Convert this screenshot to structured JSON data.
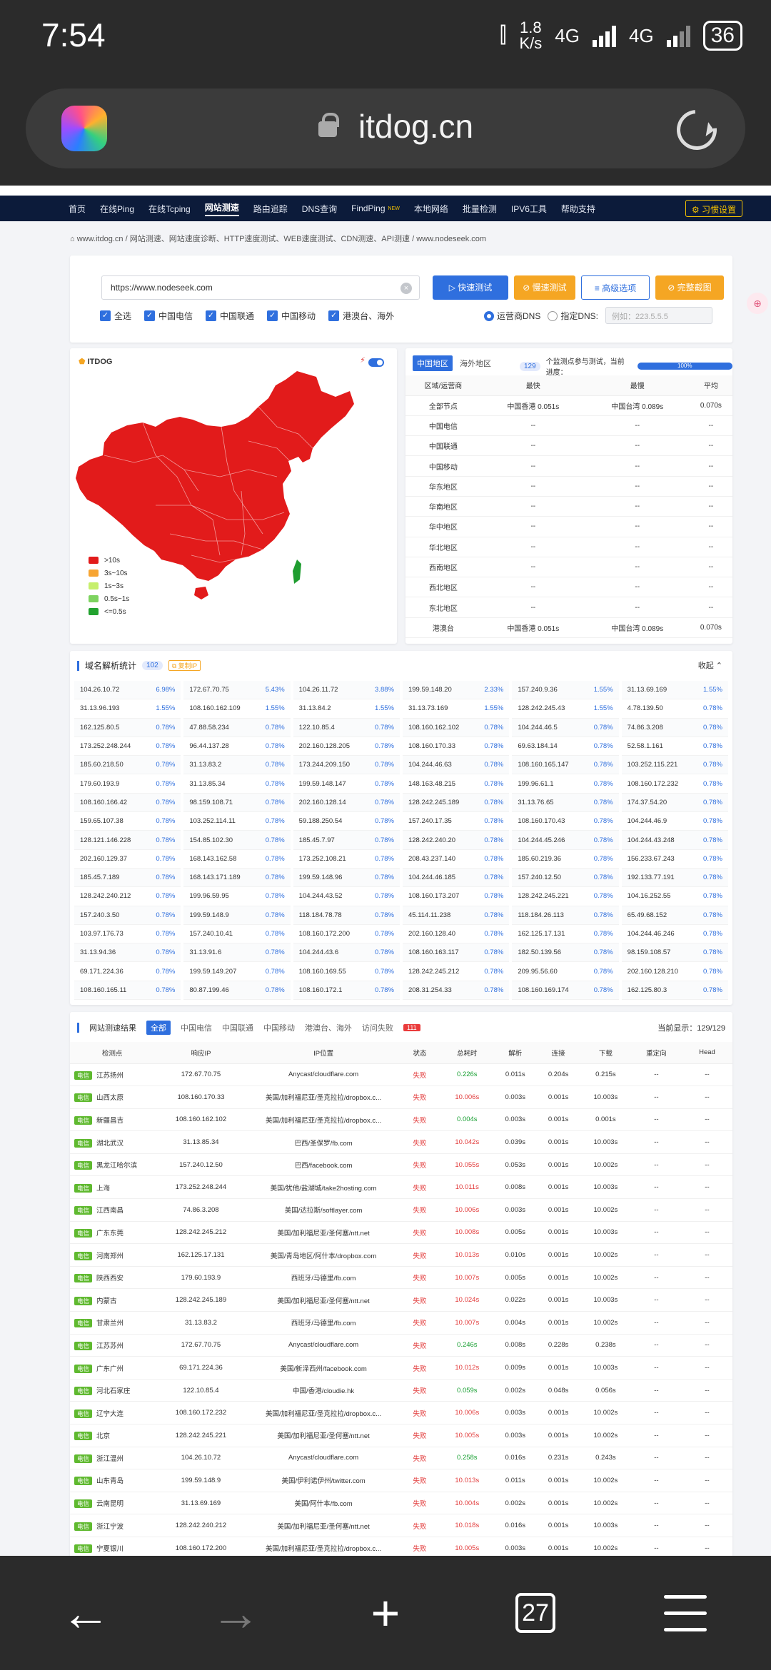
{
  "status": {
    "time": "7:54",
    "speed_top": "1.8",
    "speed_unit": "K/s",
    "net1": "4G",
    "net2": "4G",
    "battery": "36"
  },
  "browser": {
    "url": "itdog.cn",
    "tab_count": "27",
    "back": "←",
    "forward": "→",
    "new_tab": "+"
  },
  "nav": {
    "items": [
      "首页",
      "在线Ping",
      "在线Tcping",
      "网站测速",
      "路由追踪",
      "DNS查询",
      "FindPing",
      "本地网络",
      "批量检测",
      "IPV6工具",
      "帮助支持"
    ],
    "active_index": 3,
    "new_badge": "NEW",
    "settings": "习惯设置"
  },
  "breadcrumb": [
    "www.itdog.cn",
    "网站测速、网站速度诊断、HTTP速度测试、WEB速度测试、CDN测速、API测速",
    "www.nodeseek.com"
  ],
  "search": {
    "value": "https://www.nodeseek.com",
    "clear": "×",
    "buttons": {
      "fast": "▷ 快速测试",
      "slow": "⊘ 慢速测试",
      "advanced": "≡ 高级选项",
      "full": "⊘ 完整截图"
    },
    "checks": [
      "全选",
      "中国电信",
      "中国联通",
      "中国移动",
      "港澳台、海外"
    ],
    "dns_operator": "运营商DNS",
    "dns_custom": "指定DNS:",
    "dns_placeholder": "例如：223.5.5.5"
  },
  "map": {
    "logo": "ITDOG",
    "legend": [
      {
        "label": ">10s",
        "color": "#e21b1b"
      },
      {
        "label": "3s~10s",
        "color": "#f7a533"
      },
      {
        "label": "1s~3s",
        "color": "#c6ef6c"
      },
      {
        "label": "0.5s~1s",
        "color": "#7dd35f"
      },
      {
        "label": "<=0.5s",
        "color": "#22a22f"
      }
    ],
    "fill_color": "#e21b1b",
    "taiwan_color": "#1f9d30"
  },
  "regions": {
    "tab_cn": "中国地区",
    "tab_overseas": "海外地区",
    "count": "129",
    "progress_text": "个监测点参与测试，当前进度：",
    "progress": "100%",
    "headers": [
      "区域/运营商",
      "最快",
      "最慢",
      "平均"
    ],
    "rows": [
      [
        "全部节点",
        "中国香港 0.051s",
        "中国台湾 0.089s",
        "0.070s"
      ],
      [
        "中国电信",
        "--",
        "--",
        "--"
      ],
      [
        "中国联通",
        "--",
        "--",
        "--"
      ],
      [
        "中国移动",
        "--",
        "--",
        "--"
      ],
      [
        "华东地区",
        "--",
        "--",
        "--"
      ],
      [
        "华南地区",
        "--",
        "--",
        "--"
      ],
      [
        "华中地区",
        "--",
        "--",
        "--"
      ],
      [
        "华北地区",
        "--",
        "--",
        "--"
      ],
      [
        "西南地区",
        "--",
        "--",
        "--"
      ],
      [
        "西北地区",
        "--",
        "--",
        "--"
      ],
      [
        "东北地区",
        "--",
        "--",
        "--"
      ],
      [
        "港澳台",
        "中国香港 0.051s",
        "中国台湾 0.089s",
        "0.070s"
      ]
    ]
  },
  "dns_stats": {
    "title": "域名解析统计",
    "count": "102",
    "copy": "复制IP",
    "collapse": "收起 ⌃",
    "cells": [
      [
        "104.26.10.72",
        "6.98%"
      ],
      [
        "172.67.70.75",
        "5.43%"
      ],
      [
        "104.26.11.72",
        "3.88%"
      ],
      [
        "199.59.148.20",
        "2.33%"
      ],
      [
        "157.240.9.36",
        "1.55%"
      ],
      [
        "31.13.69.169",
        "1.55%"
      ],
      [
        "31.13.96.193",
        "1.55%"
      ],
      [
        "108.160.162.109",
        "1.55%"
      ],
      [
        "31.13.84.2",
        "1.55%"
      ],
      [
        "31.13.73.169",
        "1.55%"
      ],
      [
        "128.242.245.43",
        "1.55%"
      ],
      [
        "4.78.139.50",
        "0.78%"
      ],
      [
        "162.125.80.5",
        "0.78%"
      ],
      [
        "47.88.58.234",
        "0.78%"
      ],
      [
        "122.10.85.4",
        "0.78%"
      ],
      [
        "108.160.162.102",
        "0.78%"
      ],
      [
        "104.244.46.5",
        "0.78%"
      ],
      [
        "74.86.3.208",
        "0.78%"
      ],
      [
        "173.252.248.244",
        "0.78%"
      ],
      [
        "96.44.137.28",
        "0.78%"
      ],
      [
        "202.160.128.205",
        "0.78%"
      ],
      [
        "108.160.170.33",
        "0.78%"
      ],
      [
        "69.63.184.14",
        "0.78%"
      ],
      [
        "52.58.1.161",
        "0.78%"
      ],
      [
        "185.60.218.50",
        "0.78%"
      ],
      [
        "31.13.83.2",
        "0.78%"
      ],
      [
        "173.244.209.150",
        "0.78%"
      ],
      [
        "104.244.46.63",
        "0.78%"
      ],
      [
        "108.160.165.147",
        "0.78%"
      ],
      [
        "103.252.115.221",
        "0.78%"
      ],
      [
        "179.60.193.9",
        "0.78%"
      ],
      [
        "31.13.85.34",
        "0.78%"
      ],
      [
        "199.59.148.147",
        "0.78%"
      ],
      [
        "148.163.48.215",
        "0.78%"
      ],
      [
        "199.96.61.1",
        "0.78%"
      ],
      [
        "108.160.172.232",
        "0.78%"
      ],
      [
        "108.160.166.42",
        "0.78%"
      ],
      [
        "98.159.108.71",
        "0.78%"
      ],
      [
        "202.160.128.14",
        "0.78%"
      ],
      [
        "128.242.245.189",
        "0.78%"
      ],
      [
        "31.13.76.65",
        "0.78%"
      ],
      [
        "174.37.54.20",
        "0.78%"
      ],
      [
        "159.65.107.38",
        "0.78%"
      ],
      [
        "103.252.114.11",
        "0.78%"
      ],
      [
        "59.188.250.54",
        "0.78%"
      ],
      [
        "157.240.17.35",
        "0.78%"
      ],
      [
        "108.160.170.43",
        "0.78%"
      ],
      [
        "104.244.46.9",
        "0.78%"
      ],
      [
        "128.121.146.228",
        "0.78%"
      ],
      [
        "154.85.102.30",
        "0.78%"
      ],
      [
        "185.45.7.97",
        "0.78%"
      ],
      [
        "128.242.240.20",
        "0.78%"
      ],
      [
        "104.244.45.246",
        "0.78%"
      ],
      [
        "104.244.43.248",
        "0.78%"
      ],
      [
        "202.160.129.37",
        "0.78%"
      ],
      [
        "168.143.162.58",
        "0.78%"
      ],
      [
        "173.252.108.21",
        "0.78%"
      ],
      [
        "208.43.237.140",
        "0.78%"
      ],
      [
        "185.60.219.36",
        "0.78%"
      ],
      [
        "156.233.67.243",
        "0.78%"
      ],
      [
        "185.45.7.189",
        "0.78%"
      ],
      [
        "168.143.171.189",
        "0.78%"
      ],
      [
        "199.59.148.96",
        "0.78%"
      ],
      [
        "104.244.46.185",
        "0.78%"
      ],
      [
        "157.240.12.50",
        "0.78%"
      ],
      [
        "192.133.77.191",
        "0.78%"
      ],
      [
        "128.242.240.212",
        "0.78%"
      ],
      [
        "199.96.59.95",
        "0.78%"
      ],
      [
        "104.244.43.52",
        "0.78%"
      ],
      [
        "108.160.173.207",
        "0.78%"
      ],
      [
        "128.242.245.221",
        "0.78%"
      ],
      [
        "104.16.252.55",
        "0.78%"
      ],
      [
        "157.240.3.50",
        "0.78%"
      ],
      [
        "199.59.148.9",
        "0.78%"
      ],
      [
        "118.184.78.78",
        "0.78%"
      ],
      [
        "45.114.11.238",
        "0.78%"
      ],
      [
        "118.184.26.113",
        "0.78%"
      ],
      [
        "65.49.68.152",
        "0.78%"
      ],
      [
        "103.97.176.73",
        "0.78%"
      ],
      [
        "157.240.10.41",
        "0.78%"
      ],
      [
        "108.160.172.200",
        "0.78%"
      ],
      [
        "202.160.128.40",
        "0.78%"
      ],
      [
        "162.125.17.131",
        "0.78%"
      ],
      [
        "104.244.46.246",
        "0.78%"
      ],
      [
        "31.13.94.36",
        "0.78%"
      ],
      [
        "31.13.91.6",
        "0.78%"
      ],
      [
        "104.244.43.6",
        "0.78%"
      ],
      [
        "108.160.163.117",
        "0.78%"
      ],
      [
        "182.50.139.56",
        "0.78%"
      ],
      [
        "98.159.108.57",
        "0.78%"
      ],
      [
        "69.171.224.36",
        "0.78%"
      ],
      [
        "199.59.149.207",
        "0.78%"
      ],
      [
        "108.160.169.55",
        "0.78%"
      ],
      [
        "128.242.245.212",
        "0.78%"
      ],
      [
        "209.95.56.60",
        "0.78%"
      ],
      [
        "202.160.128.210",
        "0.78%"
      ],
      [
        "108.160.165.11",
        "0.78%"
      ],
      [
        "80.87.199.46",
        "0.78%"
      ],
      [
        "108.160.172.1",
        "0.78%"
      ],
      [
        "208.31.254.33",
        "0.78%"
      ],
      [
        "108.160.169.174",
        "0.78%"
      ],
      [
        "162.125.80.3",
        "0.78%"
      ]
    ]
  },
  "results": {
    "title": "网站测速结果",
    "filters": [
      "全部",
      "中国电信",
      "中国联通",
      "中国移动",
      "港澳台、海外",
      "访问失败"
    ],
    "fail_count": "111",
    "shown": "当前显示：129/129",
    "headers": [
      "检测点",
      "响应IP",
      "IP位置",
      "状态",
      "总耗时",
      "解析",
      "连接",
      "下载",
      "重定向",
      "Head"
    ],
    "rows": [
      [
        "电信",
        "江苏扬州",
        "172.67.70.75",
        "Anycast/cloudflare.com",
        "失败",
        "0.226s",
        "g",
        "0.011s",
        "0.204s",
        "0.215s",
        "--",
        "--"
      ],
      [
        "电信",
        "山西太原",
        "108.160.170.33",
        "美国/加利福尼亚/圣克拉拉/dropbox.c...",
        "失败",
        "10.006s",
        "r",
        "0.003s",
        "0.001s",
        "10.003s",
        "--",
        "--"
      ],
      [
        "电信",
        "新疆昌吉",
        "108.160.162.102",
        "美国/加利福尼亚/圣克拉拉/dropbox.c...",
        "失败",
        "0.004s",
        "g",
        "0.003s",
        "0.001s",
        "0.001s",
        "--",
        "--"
      ],
      [
        "电信",
        "湖北武汉",
        "31.13.85.34",
        "巴西/圣保罗/fb.com",
        "失败",
        "10.042s",
        "r",
        "0.039s",
        "0.001s",
        "10.003s",
        "--",
        "--"
      ],
      [
        "电信",
        "黑龙江哈尔滨",
        "157.240.12.50",
        "巴西/facebook.com",
        "失败",
        "10.055s",
        "r",
        "0.053s",
        "0.001s",
        "10.002s",
        "--",
        "--"
      ],
      [
        "电信",
        "上海",
        "173.252.248.244",
        "美国/犹他/盐湖城/take2hosting.com",
        "失败",
        "10.011s",
        "r",
        "0.008s",
        "0.001s",
        "10.003s",
        "--",
        "--"
      ],
      [
        "电信",
        "江西南昌",
        "74.86.3.208",
        "美国/达拉斯/softlayer.com",
        "失败",
        "10.006s",
        "r",
        "0.003s",
        "0.001s",
        "10.002s",
        "--",
        "--"
      ],
      [
        "电信",
        "广东东莞",
        "128.242.245.212",
        "美国/加利福尼亚/圣何塞/ntt.net",
        "失败",
        "10.008s",
        "r",
        "0.005s",
        "0.001s",
        "10.003s",
        "--",
        "--"
      ],
      [
        "电信",
        "河南郑州",
        "162.125.17.131",
        "美国/青岛地区/阿什本/dropbox.com",
        "失败",
        "10.013s",
        "r",
        "0.010s",
        "0.001s",
        "10.002s",
        "--",
        "--"
      ],
      [
        "电信",
        "陕西西安",
        "179.60.193.9",
        "西班牙/马德里/fb.com",
        "失败",
        "10.007s",
        "r",
        "0.005s",
        "0.001s",
        "10.002s",
        "--",
        "--"
      ],
      [
        "电信",
        "内蒙古",
        "128.242.245.189",
        "美国/加利福尼亚/圣何塞/ntt.net",
        "失败",
        "10.024s",
        "r",
        "0.022s",
        "0.001s",
        "10.003s",
        "--",
        "--"
      ],
      [
        "电信",
        "甘肃兰州",
        "31.13.83.2",
        "西班牙/马德里/fb.com",
        "失败",
        "10.007s",
        "r",
        "0.004s",
        "0.001s",
        "10.002s",
        "--",
        "--"
      ],
      [
        "电信",
        "江苏苏州",
        "172.67.70.75",
        "Anycast/cloudflare.com",
        "失败",
        "0.246s",
        "g",
        "0.008s",
        "0.228s",
        "0.238s",
        "--",
        "--"
      ],
      [
        "电信",
        "广东广州",
        "69.171.224.36",
        "美国/新泽西州/facebook.com",
        "失败",
        "10.012s",
        "r",
        "0.009s",
        "0.001s",
        "10.003s",
        "--",
        "--"
      ],
      [
        "电信",
        "河北石家庄",
        "122.10.85.4",
        "中国/香港/cloudie.hk",
        "失败",
        "0.059s",
        "g",
        "0.002s",
        "0.048s",
        "0.056s",
        "--",
        "--"
      ],
      [
        "电信",
        "辽宁大连",
        "108.160.172.232",
        "美国/加利福尼亚/圣克拉拉/dropbox.c...",
        "失败",
        "10.006s",
        "r",
        "0.003s",
        "0.001s",
        "10.002s",
        "--",
        "--"
      ],
      [
        "电信",
        "北京",
        "128.242.245.221",
        "美国/加利福尼亚/圣何塞/ntt.net",
        "失败",
        "10.005s",
        "r",
        "0.003s",
        "0.001s",
        "10.002s",
        "--",
        "--"
      ],
      [
        "电信",
        "浙江温州",
        "104.26.10.72",
        "Anycast/cloudflare.com",
        "失败",
        "0.258s",
        "g",
        "0.016s",
        "0.231s",
        "0.243s",
        "--",
        "--"
      ],
      [
        "电信",
        "山东青岛",
        "199.59.148.9",
        "美国/伊利诺伊州/twitter.com",
        "失败",
        "10.013s",
        "r",
        "0.011s",
        "0.001s",
        "10.002s",
        "--",
        "--"
      ],
      [
        "电信",
        "云南昆明",
        "31.13.69.169",
        "美国/阿什本/fb.com",
        "失败",
        "10.004s",
        "r",
        "0.002s",
        "0.001s",
        "10.002s",
        "--",
        "--"
      ],
      [
        "电信",
        "浙江宁波",
        "128.242.240.212",
        "美国/加利福尼亚/圣何塞/ntt.net",
        "失败",
        "10.018s",
        "r",
        "0.016s",
        "0.001s",
        "10.003s",
        "--",
        "--"
      ],
      [
        "电信",
        "宁夏银川",
        "108.160.172.200",
        "美国/加利福尼亚/圣克拉拉/dropbox.c...",
        "失败",
        "10.005s",
        "r",
        "0.003s",
        "0.001s",
        "10.002s",
        "--",
        "--"
      ]
    ]
  },
  "colors": {
    "accent": "#2f6fde",
    "nav_bg": "#0c1b3a",
    "fail": "#e23b3b",
    "ok": "#19a033",
    "tag": "#5fb92f"
  }
}
